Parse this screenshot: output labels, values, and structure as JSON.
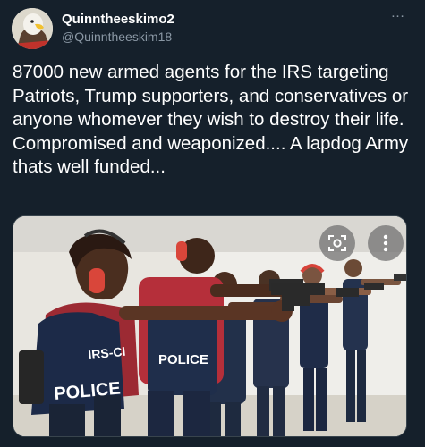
{
  "tweet": {
    "display_name": "Quinntheeskimo2",
    "handle": "@Quinntheeskim18",
    "text": "87000 new armed agents for the IRS targeting Patriots, Trump supporters, and conservatives or anyone whomever they wish to destroy their life. Compromised and weaponized.... A lapdog Army thats well funded...",
    "more_icon": "…"
  },
  "media": {
    "vest_labels": [
      "IRS-CI",
      "POLICE",
      "POLICE"
    ],
    "buttons": [
      "lens-search-icon",
      "more-vertical-icon"
    ]
  }
}
